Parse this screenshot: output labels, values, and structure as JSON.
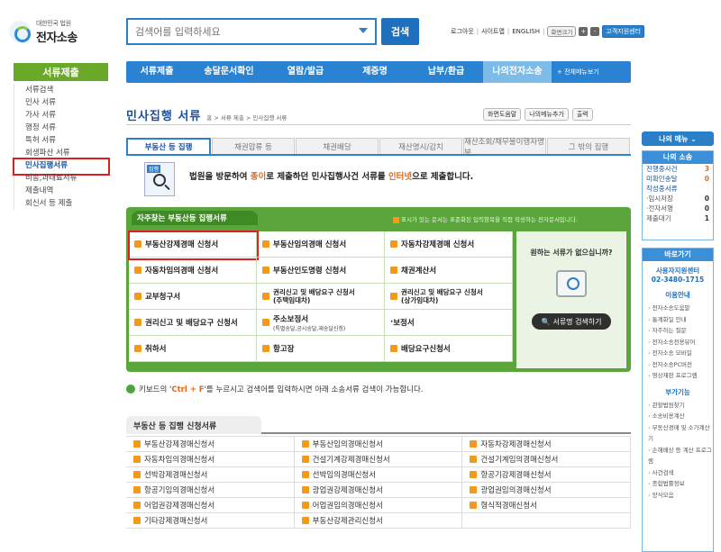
{
  "header": {
    "logo_small": "대한민국 법원",
    "logo_big": "전자소송",
    "search_placeholder": "검색어를 입력하세요",
    "search_button": "검색",
    "util": {
      "logout": "로그아웃",
      "sitemap": "사이트맵",
      "english": "ENGLISH",
      "zoom": "화면크기",
      "plus": "+",
      "minus": "-",
      "gov": "고객지원센터"
    }
  },
  "left_menu": {
    "title": "서류제출",
    "items": [
      "서류검색",
      "민사 서류",
      "가사 서류",
      "행정 서류",
      "특허 서류",
      "회생파산 서류",
      "민사집행서류",
      "비송,과태료서류",
      "제출내역",
      "회신서 등 제출"
    ],
    "active_index": 6
  },
  "topnav": {
    "items": [
      "서류제출",
      "송달문서확인",
      "열람/발급",
      "제증명",
      "납부/환급",
      "나의전자소송"
    ],
    "current_index": 5,
    "all_menu": "+ 전체메뉴보기"
  },
  "page": {
    "title": "민사집행 서류",
    "breadcrumb": "홈 > 서류 제출 > 민사집행 서류",
    "tools": [
      "화면도움말",
      "나의메뉴추가",
      "출력"
    ]
  },
  "tabs": [
    "부동산 등 집행",
    "채권압류 등",
    "채권배당",
    "재산명시/감치",
    "재산조회/채무불이행자명부",
    "그 밖의 집행"
  ],
  "tab_active": 0,
  "intro": {
    "icon_tag": "집행",
    "t1": "법원을 방문하여 ",
    "t2": "종이",
    "t3": "로 제출하던 민사집행사건 서류를 ",
    "t4": "인터넷",
    "t5": "으로 제출합니다."
  },
  "panel": {
    "title": "자주찾는 부동산등 집행서류",
    "note": "표시가 있는 문서는 표준화된 입력항목을 직접 작성하는 전자문서입니다.",
    "cells": [
      {
        "l1": "부동산강제경매 신청서",
        "l2": "",
        "sub": "",
        "mark": true
      },
      {
        "l1": "부동산임의경매 신청서",
        "l2": "",
        "sub": "",
        "mark": true
      },
      {
        "l1": "자동차강제경매 신청서",
        "l2": "",
        "sub": "",
        "mark": true
      },
      {
        "l1": "자동차임의경매 신청서",
        "l2": "",
        "sub": "",
        "mark": true
      },
      {
        "l1": "부동산인도명령 신청서",
        "l2": "",
        "sub": "",
        "mark": true
      },
      {
        "l1": "채권계산서",
        "l2": "",
        "sub": "",
        "mark": true
      },
      {
        "l1": "교부청구서",
        "l2": "",
        "sub": "",
        "mark": true
      },
      {
        "l1": "권리신고 및 배당요구 신청서",
        "l2": "(주택임대차)",
        "sub": "",
        "mark": true
      },
      {
        "l1": "권리신고 및 배당요구 신청서",
        "l2": "(상가임대차)",
        "sub": "",
        "mark": true
      },
      {
        "l1": "권리신고 및 배당요구 신청서",
        "l2": "",
        "sub": "",
        "mark": true
      },
      {
        "l1": "주소보정서",
        "l2": "",
        "sub": "(특별송달,공시송달,재송달신청)",
        "mark": true
      },
      {
        "l1": "보정서",
        "l2": "",
        "sub": "",
        "mark": false
      },
      {
        "l1": "취하서",
        "l2": "",
        "sub": "",
        "mark": true
      },
      {
        "l1": "항고장",
        "l2": "",
        "sub": "",
        "mark": true
      },
      {
        "l1": "배당요구신청서",
        "l2": "",
        "sub": "",
        "mark": true
      }
    ],
    "side_question": "원하는 서류가 없으십니까?",
    "side_button": "서류명 검색하기"
  },
  "hint": {
    "pre": "키보드의 '",
    "key": "Ctrl + F",
    "post": "'를 누르시고 검색어를 입력하시면 아래 소송서류 검색이 가능합니다."
  },
  "list": {
    "title": "부동산 등 집행 신청서류",
    "items": [
      "부동산강제경매신청서",
      "부동산임의경매신청서",
      "자동차강제경매신청서",
      "자동차임의경매신청서",
      "건설기계강제경매신청서",
      "건설기계임의경매신청서",
      "선박강제경매신청서",
      "선박임의경매신청서",
      "항공기강제경매신청서",
      "항공기임의경매신청서",
      "광업권강제경매신청서",
      "광업권임의경매신청서",
      "어업권강제경매신청서",
      "어업권임의경매신청서",
      "형식적경매신청서",
      "기타강제경매신청서",
      "부동산강제관리신청서",
      ""
    ]
  },
  "right": {
    "mymenu": "나의 메뉴 ⌄",
    "box_title": "나의 소송",
    "rows": [
      {
        "k": "진행중사건",
        "v": "3"
      },
      {
        "k": "미확인송달",
        "v": "0"
      },
      {
        "k": "작성중서류",
        "v": ""
      },
      {
        "k": "·임시저장",
        "v": "0"
      },
      {
        "k": "·전자서명",
        "v": "0"
      },
      {
        "k": "제출대기",
        "v": "1"
      }
    ],
    "links_title": "바로가기",
    "contact1": "사용자지원센터",
    "contact2": "02-3480-1715",
    "sec1": "이용안내",
    "links1": [
      "전자소송도움말",
      "통계화일 안내",
      "자주하는 질문",
      "전자소송전용뷰어",
      "전자소송 모바일",
      "전자소송PC버전",
      "영상재판 프로그램"
    ],
    "sec2": "부가기능",
    "links2": [
      "관할법원찾기",
      "소송비용계산",
      "부동산경매 및 소가계산기",
      "손해배상 등 계산 프로그램",
      "사건검색",
      "종합법률정보",
      "양식모음"
    ]
  },
  "colors": {
    "nav_blue": "#2a82d2",
    "green": "#5aa53c",
    "orange_mark": "#f39a1e",
    "highlight_red": "#e02020"
  }
}
